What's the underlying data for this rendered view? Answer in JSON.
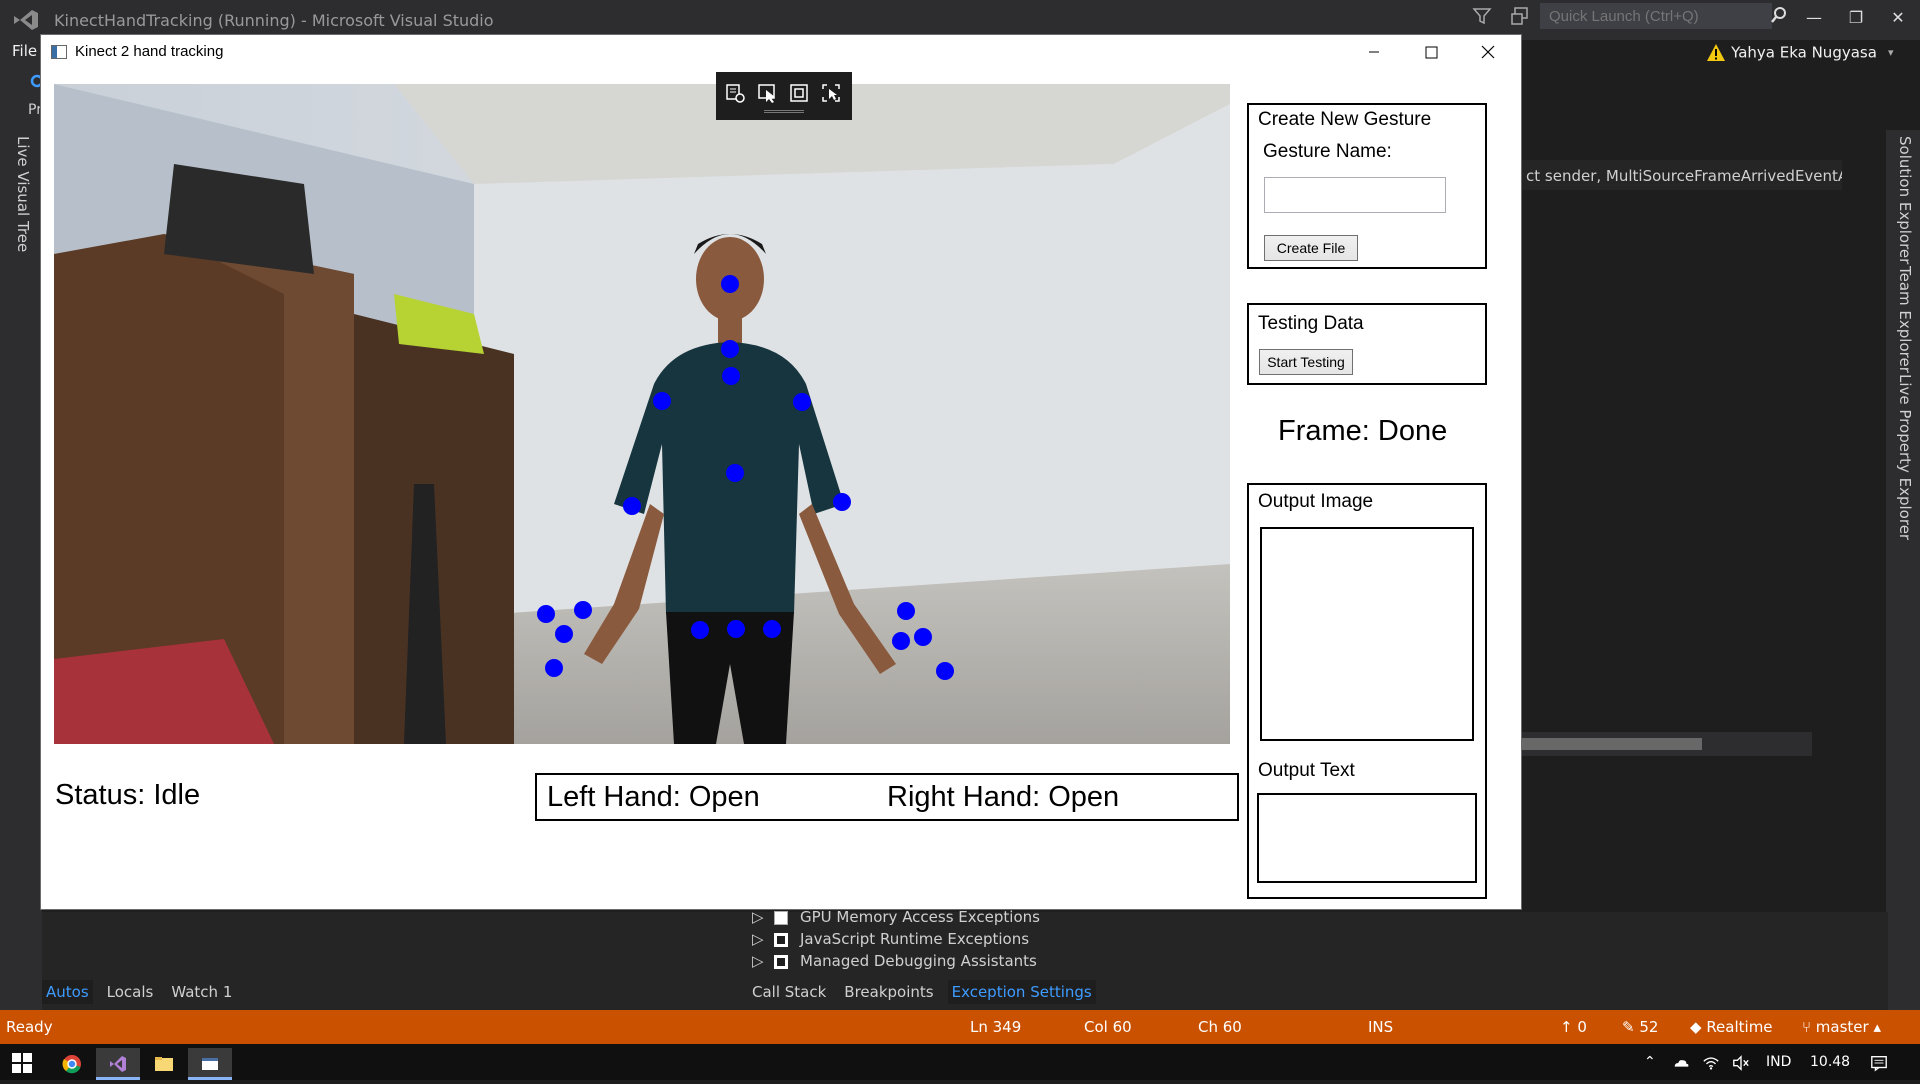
{
  "vs": {
    "title": "KinectHandTracking (Running) - Microsoft Visual Studio",
    "quick_launch_placeholder": "Quick Launch (Ctrl+Q)",
    "menu_file": "File",
    "user_name": "Yahya Eka Nugyasa",
    "left_tool_tab": "Live Visual Tree",
    "right_tool_tabs": [
      "Solution Explorer",
      "Team Explorer",
      "Live Property Explorer"
    ],
    "editor_member_dropdown": "ct sender, MultiSourceFrameArrivedEventArg",
    "exception_rows": [
      {
        "label": "GPU Memory Access Exceptions",
        "checked": false
      },
      {
        "label": "JavaScript Runtime Exceptions",
        "checked": true
      },
      {
        "label": "Managed Debugging Assistants",
        "checked": true
      }
    ],
    "bottom_tabs_left": [
      "Autos",
      "Locals",
      "Watch 1"
    ],
    "bottom_tabs_left_active": "Autos",
    "bottom_tabs_right": [
      "Call Stack",
      "Breakpoints",
      "Exception Settings"
    ],
    "bottom_tabs_right_active": "Exception Settings",
    "status": {
      "ready": "Ready",
      "line": "Ln 349",
      "col": "Col 60",
      "ch": "Ch 60",
      "mode": "INS",
      "push_count": "0",
      "pending_changes": "52",
      "repo": "Realtime",
      "branch": "master"
    },
    "accent_status_color": "#ca5100"
  },
  "taskbar": {
    "language": "IND",
    "time": "10.48"
  },
  "app": {
    "title": "Kinect 2 hand tracking",
    "create_gesture": {
      "title": "Create New Gesture",
      "name_label": "Gesture Name:",
      "name_value": "",
      "create_button": "Create File"
    },
    "testing": {
      "title": "Testing Data",
      "start_button": "Start Testing"
    },
    "frame_status": "Frame: Done",
    "output_image_title": "Output Image",
    "output_text_title": "Output Text",
    "status": "Status: Idle",
    "left_hand": "Left Hand: Open",
    "right_hand": "Right Hand: Open",
    "joint_color": "#0000ff"
  }
}
